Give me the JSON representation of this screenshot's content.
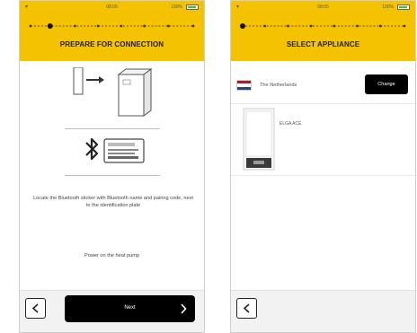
{
  "left_screen": {
    "status": {
      "time": "08:05",
      "battery": "100%"
    },
    "title": "PREPARE FOR CONNECTION",
    "instruction": "Locate the Bluetooth sticker with Bluetooth name and pairing code, next to the identification plate",
    "power_text": "Power on the heat pump",
    "next_label": "Next"
  },
  "right_screen": {
    "status": {
      "time": "08:05",
      "battery": "100%"
    },
    "title": "SELECT APPLIANCE",
    "country": "The Netherlands",
    "change_label": "Change",
    "appliance_name": "ELGA ACE"
  },
  "colors": {
    "accent_yellow": "#f5c200",
    "button_black": "#000000",
    "battery_green": "#3cbf3c"
  },
  "icons": {
    "status_left": "wifi-icon",
    "battery": "battery-icon",
    "bluetooth": "bluetooth-icon",
    "back": "chevron-left-icon",
    "next": "chevron-right-icon"
  }
}
